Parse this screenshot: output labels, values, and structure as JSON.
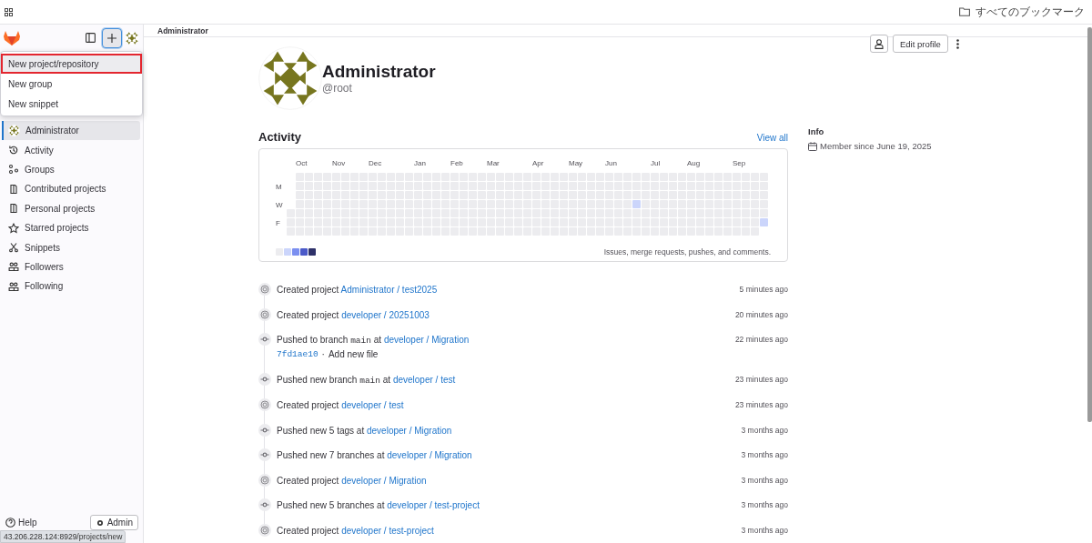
{
  "browser_bar": {
    "bookmarks_label": "すべてのブックマーク"
  },
  "sidebar": {
    "create_button": {
      "expanded": true
    },
    "create_menu": [
      {
        "label": "New project/repository",
        "selected": true
      },
      {
        "label": "New group",
        "selected": false
      },
      {
        "label": "New snippet",
        "selected": false
      }
    ],
    "items": [
      {
        "label": "Administrator",
        "kind": "avatar",
        "selected": true
      },
      {
        "label": "Activity",
        "kind": "history",
        "selected": false
      },
      {
        "label": "Groups",
        "kind": "groups",
        "selected": false
      },
      {
        "label": "Contributed projects",
        "kind": "project",
        "selected": false
      },
      {
        "label": "Personal projects",
        "kind": "project",
        "selected": false
      },
      {
        "label": "Starred projects",
        "kind": "star",
        "selected": false
      },
      {
        "label": "Snippets",
        "kind": "snippet",
        "selected": false
      },
      {
        "label": "Followers",
        "kind": "users",
        "selected": false
      },
      {
        "label": "Following",
        "kind": "users",
        "selected": false
      }
    ],
    "help": "Help",
    "admin": "Admin"
  },
  "status_url": "43.206.228.124:8929/projects/new",
  "breadcrumb": "Administrator",
  "profile": {
    "name": "Administrator",
    "username": "@root",
    "edit_button": "Edit profile"
  },
  "activity": {
    "title": "Activity",
    "view_all": "View all",
    "months": [
      "Oct",
      "Nov",
      "Dec",
      "Jan",
      "Feb",
      "Mar",
      "Apr",
      "May",
      "Jun",
      "Jul",
      "Aug",
      "Sep"
    ],
    "weekdays": [
      "M",
      "W",
      "F"
    ],
    "legend": [
      {
        "color": "#ececef"
      },
      {
        "color": "#cbd5fb"
      },
      {
        "color": "#7b8ff0"
      },
      {
        "color": "#4b5ac9"
      },
      {
        "color": "#2e3169"
      }
    ],
    "caption": "Issues, merge requests, pushes, and comments."
  },
  "events": [
    {
      "kind": "created",
      "action": "Created project",
      "project": "Administrator / test2025",
      "time": "5 minutes ago"
    },
    {
      "kind": "created",
      "action": "Created project",
      "project": "developer / 20251003",
      "time": "20 minutes ago"
    },
    {
      "kind": "pushed",
      "action": "Pushed to branch",
      "branch": "main",
      "preposition": "at",
      "project": "developer / Migration",
      "time": "22 minutes ago",
      "commit": {
        "sha": "7fd1ae10",
        "separator": "·",
        "message": "Add new file"
      }
    },
    {
      "kind": "pushed",
      "action": "Pushed new branch",
      "branch": "main",
      "preposition": "at",
      "project": "developer / test",
      "time": "23 minutes ago"
    },
    {
      "kind": "created",
      "action": "Created project",
      "project": "developer / test",
      "time": "23 minutes ago"
    },
    {
      "kind": "pushed",
      "action": "Pushed new 5 tags",
      "preposition": "at",
      "project": "developer / Migration",
      "time": "3 months ago"
    },
    {
      "kind": "pushed",
      "action": "Pushed new 7 branches",
      "preposition": "at",
      "project": "developer / Migration",
      "time": "3 months ago"
    },
    {
      "kind": "created",
      "action": "Created project",
      "project": "developer / Migration",
      "time": "3 months ago"
    },
    {
      "kind": "pushed",
      "action": "Pushed new 5 branches",
      "preposition": "at",
      "project": "developer / test-project",
      "time": "3 months ago"
    },
    {
      "kind": "created",
      "action": "Created project",
      "project": "developer / test-project",
      "time": "3 months ago"
    }
  ],
  "info": {
    "title": "Info",
    "member_since": "Member since June 19, 2025"
  }
}
